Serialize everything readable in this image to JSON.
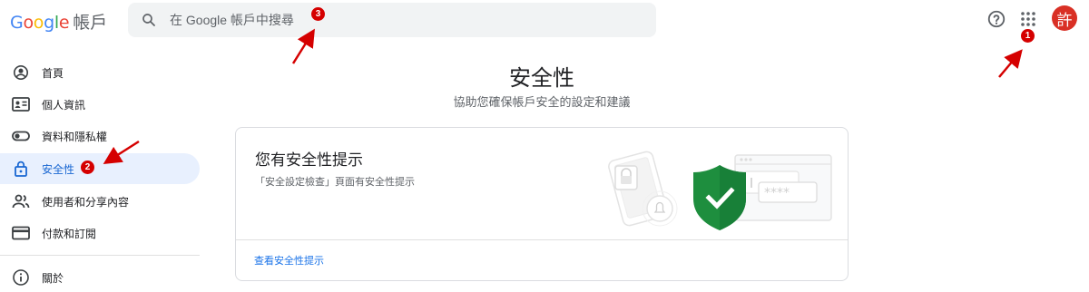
{
  "header": {
    "logo_letters": [
      {
        "char": "G",
        "color": "#4285f4"
      },
      {
        "char": "o",
        "color": "#ea4335"
      },
      {
        "char": "o",
        "color": "#fbbc05"
      },
      {
        "char": "g",
        "color": "#4285f4"
      },
      {
        "char": "l",
        "color": "#34a853"
      },
      {
        "char": "e",
        "color": "#ea4335"
      }
    ],
    "logo_text": "帳戶",
    "search_placeholder": "在 Google 帳戶中搜尋",
    "help_icon": "help-circle-icon",
    "apps_icon": "apps-grid-icon",
    "avatar_initial": "許",
    "avatar_color": "#d93025"
  },
  "sidebar": {
    "items": [
      {
        "label": "首頁",
        "icon": "account-circle-icon",
        "active": false
      },
      {
        "label": "個人資訊",
        "icon": "id-card-icon",
        "active": false
      },
      {
        "label": "資料和隱私權",
        "icon": "toggle-icon",
        "active": false
      },
      {
        "label": "安全性",
        "icon": "lock-icon",
        "active": true
      },
      {
        "label": "使用者和分享內容",
        "icon": "people-icon",
        "active": false
      },
      {
        "label": "付款和訂閱",
        "icon": "credit-card-icon",
        "active": false
      },
      {
        "label": "關於",
        "icon": "info-icon",
        "active": false
      }
    ]
  },
  "main": {
    "title": "安全性",
    "subtitle": "協助您確保帳戶安全的設定和建議",
    "card": {
      "title": "您有安全性提示",
      "description": "「安全設定檢查」頁面有安全性提示",
      "link": "查看安全性提示",
      "password_mask": "****",
      "shield_color": "#1e8e3e"
    }
  },
  "annotations": {
    "markers": [
      "1",
      "2",
      "3"
    ],
    "color": "#d50000"
  },
  "colors": {
    "accent": "#1a73e8",
    "active_bg": "#e8f0fe",
    "active_text": "#1967d2"
  }
}
